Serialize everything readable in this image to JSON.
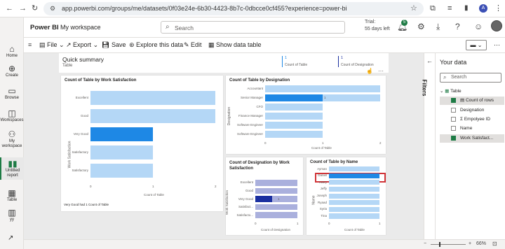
{
  "browser": {
    "url": "app.powerbi.com/groups/me/datasets/0f03e24e-6b30-4423-8b7c-0dbcce0cf455?experience=power-bi",
    "back_icon": "arrow-left",
    "forward_icon": "arrow-right",
    "refresh_icon": "refresh",
    "profile_initial": "A"
  },
  "header": {
    "app_name": "Power BI",
    "workspace": "My workspace",
    "search_placeholder": "Search",
    "trial_line1": "Trial:",
    "trial_line2": "55 days left",
    "notif_count": "5"
  },
  "toolbar": {
    "file": "File",
    "export": "Export",
    "save": "Save",
    "explore": "Explore this data",
    "edit": "Edit",
    "show_table": "Show data table"
  },
  "nav": [
    {
      "label": "Home",
      "icon": "home-icon"
    },
    {
      "label": "Create",
      "icon": "create-icon"
    },
    {
      "label": "Browse",
      "icon": "browse-icon"
    },
    {
      "label": "Workspaces",
      "icon": "workspaces-icon"
    },
    {
      "label": "My workspace",
      "icon": "my-workspace-icon"
    },
    {
      "label": "Untitled report",
      "icon": "report-icon"
    },
    {
      "label": "Table",
      "icon": "table-icon"
    },
    {
      "label": "yy",
      "icon": "dataset-icon"
    }
  ],
  "quick_summary": {
    "title": "Quick summary",
    "subtitle": "Table",
    "kpi1_value": "1",
    "kpi1_label": "Count of Table",
    "kpi2_value": "1",
    "kpi2_label": "Count of Designation"
  },
  "charts": {
    "ws": {
      "title": "Count of Table by Work Satisfaction",
      "ylabel": "Work Satisfaction",
      "xlabel": "Count of Table",
      "footnote": "Very Good had 1 Count of Table",
      "categories": [
        "Excellent",
        "Good",
        "Very Good",
        "Satisfactory",
        "Satisfactory"
      ],
      "x_ticks": [
        "0",
        "1",
        "2"
      ]
    },
    "des": {
      "title": "Count of Table by Designation",
      "ylabel": "Designation",
      "xlabel": "Count of Table",
      "categories": [
        "Accountant",
        "Senior Manager",
        "CFO",
        "Finance Manager",
        "Software Engineer",
        "Software Engineer"
      ],
      "x_ticks": [
        "0",
        "1",
        "2"
      ]
    },
    "dws": {
      "title": "Count of Designation by Work Satisfaction",
      "ylabel": "Work Satisfaction",
      "xlabel": "Count of Designation",
      "categories": [
        "Excellent",
        "Good",
        "Very Good",
        "Satisfact...",
        "Satisfacto..."
      ],
      "x_ticks": [
        "0",
        "1"
      ]
    },
    "name": {
      "title": "Count of Table by Name",
      "ylabel": "Name",
      "xlabel": "Count of Table",
      "categories": [
        "Ayman",
        "Daniel",
        "Harry",
        "Jeffy",
        "Joseph",
        "Ryaad",
        "Syria",
        "Tina"
      ],
      "x_ticks": [
        "0",
        "1"
      ]
    }
  },
  "chart_data": [
    {
      "type": "bar",
      "title": "Count of Table by Work Satisfaction",
      "categories": [
        "Excellent",
        "Good",
        "Very Good",
        "Satisfactory",
        "Satisfactory"
      ],
      "values": [
        2,
        2,
        1,
        1,
        1
      ],
      "xlim": [
        0,
        2
      ],
      "highlight_values": [
        0,
        0,
        1,
        0,
        0
      ],
      "data_labels": [
        "",
        "",
        "1",
        "",
        ""
      ]
    },
    {
      "type": "bar",
      "title": "Count of Table by Designation",
      "categories": [
        "Accountant",
        "Senior Manager",
        "CFO",
        "Finance Manager",
        "Software Engineer",
        "Software Engineer"
      ],
      "values": [
        2,
        2,
        1,
        1,
        1,
        1
      ],
      "xlim": [
        0,
        2
      ],
      "highlight_values": [
        0,
        1,
        0,
        0,
        0,
        0
      ],
      "data_labels": [
        "",
        "1",
        "",
        "",
        "",
        ""
      ]
    },
    {
      "type": "bar",
      "title": "Count of Designation by Work Satisfaction",
      "categories": [
        "Excellent",
        "Good",
        "Very Good",
        "Satisfact...",
        "Satisfacto..."
      ],
      "values": [
        1,
        1,
        1,
        1,
        1
      ],
      "xlim": [
        0,
        1
      ],
      "highlight_values": [
        0,
        0,
        0.4,
        0,
        0
      ],
      "data_labels": [
        "",
        "",
        "1",
        "",
        ""
      ]
    },
    {
      "type": "bar",
      "title": "Count of Table by Name",
      "categories": [
        "Ayman",
        "Daniel",
        "Harry",
        "Jeffy",
        "Joseph",
        "Ryaad",
        "Syria",
        "Tina"
      ],
      "values": [
        1,
        1,
        1,
        1,
        1,
        1,
        1,
        1
      ],
      "xlim": [
        0,
        1
      ],
      "highlight_values": [
        0,
        1,
        0,
        0,
        0,
        0,
        0,
        0
      ],
      "data_labels": [
        "",
        "1",
        "",
        "",
        "",
        "",
        "",
        ""
      ]
    }
  ],
  "panel": {
    "filters_label": "Filters",
    "your_data": "Your data",
    "search_placeholder": "Search",
    "table_name": "Table",
    "fields": [
      {
        "label": "Count of rows",
        "checked": true,
        "prefix": ""
      },
      {
        "label": "Designation",
        "checked": false,
        "prefix": ""
      },
      {
        "label": "Empolyee ID",
        "checked": false,
        "prefix": "Σ"
      },
      {
        "label": "Name",
        "checked": false,
        "prefix": ""
      },
      {
        "label": "Work Satisfact...",
        "checked": true,
        "prefix": ""
      }
    ]
  },
  "status": {
    "zoom": "66%"
  },
  "colors": {
    "bar": "#b4d7f6",
    "bar_selected": "#1e88e5",
    "bar2": "#aab0dd",
    "bar2_selected": "#1a2fa0",
    "highlight_box": "#d13438",
    "check": "#1e7b45"
  }
}
